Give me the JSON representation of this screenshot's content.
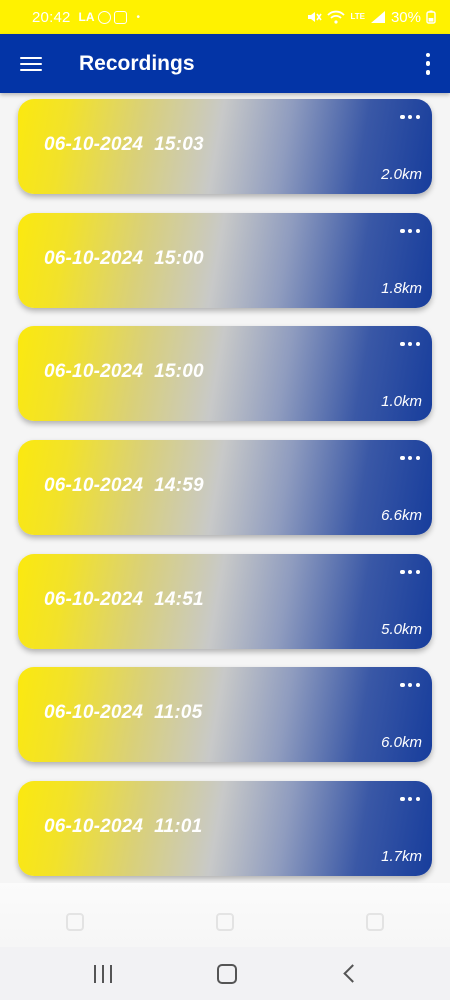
{
  "status_bar": {
    "time": "20:42",
    "notification_text": "LA",
    "dot": "•",
    "battery": "30%",
    "network_label": "LTE",
    "background": "#fff200"
  },
  "app_bar": {
    "title": "Recordings",
    "background": "#0334a6",
    "menu_icon": "hamburger-menu-icon",
    "overflow_icon": "more-vertical-icon"
  },
  "recordings": [
    {
      "date": "06-10-2024  15:03",
      "distance": "2.0km"
    },
    {
      "date": "06-10-2024  15:00",
      "distance": "1.8km"
    },
    {
      "date": "06-10-2024  15:00",
      "distance": "1.0km"
    },
    {
      "date": "06-10-2024  14:59",
      "distance": "6.6km"
    },
    {
      "date": "06-10-2024  14:51",
      "distance": "5.0km"
    },
    {
      "date": "06-10-2024  11:05",
      "distance": "6.0km"
    },
    {
      "date": "06-10-2024  11:01",
      "distance": "1.7km"
    }
  ],
  "card_colors": {
    "gradient_start": "#fbe90f",
    "gradient_end": "#173d9c"
  },
  "nav_bar": {
    "recents_icon": "recents-icon",
    "home_icon": "home-icon",
    "back_icon": "back-icon"
  }
}
